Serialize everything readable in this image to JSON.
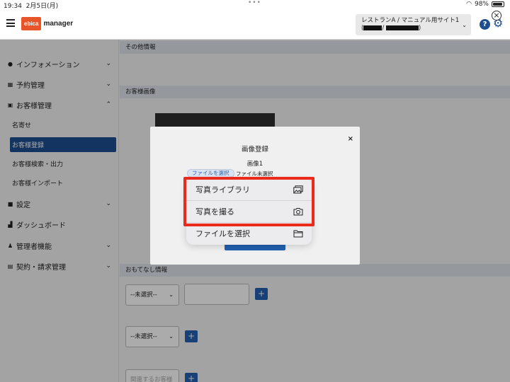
{
  "status_bar": {
    "time": "19:34",
    "date": "2月5日(月)",
    "dots": "•••",
    "battery": "98%"
  },
  "header": {
    "logo_badge": "ebica",
    "logo_text": "manager",
    "store_line1": "レストランA / マニュアル用サイト1",
    "store_line2_open": "(",
    "store_line2_sep": "/",
    "store_line2_close": ")",
    "help": "?",
    "gear": "⚙",
    "close": "×"
  },
  "sidebar": {
    "items": [
      {
        "label": "インフォメーション",
        "icon": "info-icon",
        "glyph": "●",
        "arrow": "⌄"
      },
      {
        "label": "予約管理",
        "icon": "calendar-icon",
        "glyph": "▦",
        "arrow": "⌄"
      },
      {
        "label": "お客様管理",
        "icon": "address-card-icon",
        "glyph": "▣",
        "arrow": "⌃"
      },
      {
        "label": "設定",
        "icon": "folder-icon",
        "glyph": "■",
        "arrow": "⌄"
      },
      {
        "label": "ダッシュボード",
        "icon": "chart-icon",
        "glyph": "▟",
        "arrow": ""
      },
      {
        "label": "管理者機能",
        "icon": "users-icon",
        "glyph": "♟",
        "arrow": "⌄"
      },
      {
        "label": "契約・請求管理",
        "icon": "document-icon",
        "glyph": "▤",
        "arrow": "⌄"
      }
    ],
    "sub_items": [
      "名寄せ",
      "お客様登録",
      "お客様検索・出力",
      "お客様インポート"
    ],
    "active_sub": "お客様登録"
  },
  "main": {
    "sections": [
      "その他情報",
      "お客様画像",
      "おもてなし情報"
    ],
    "select1": "--未選択--",
    "select2": "--未選択--",
    "plus": "+",
    "related_placeholder": "関連するお客様"
  },
  "modal": {
    "title": "画像登録",
    "close": "×",
    "image_label": "画像1",
    "file_button": "ファイルを選択",
    "file_status": "ファイル未選択"
  },
  "popover": {
    "items": [
      {
        "label": "写真ライブラリ",
        "icon": "photo-library-icon"
      },
      {
        "label": "写真を撮る",
        "icon": "camera-icon"
      },
      {
        "label": "ファイルを選択",
        "icon": "folder-icon"
      }
    ]
  },
  "colors": {
    "primary": "#1d4e8f",
    "accent": "#2160b0",
    "logo": "#e8552a",
    "highlight": "#ea2a1a"
  }
}
